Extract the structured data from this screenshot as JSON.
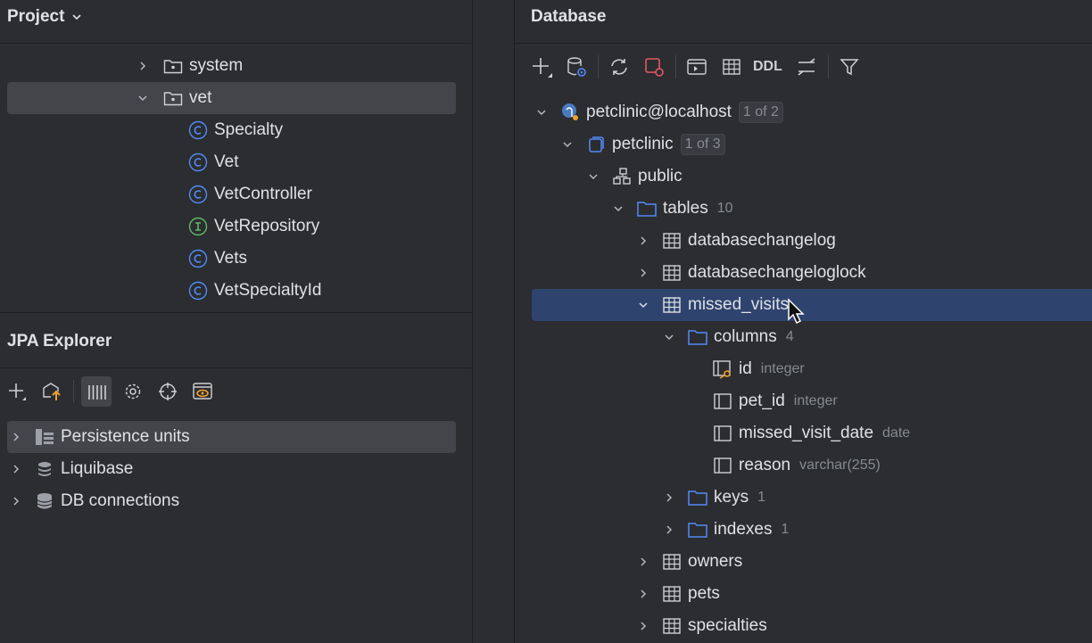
{
  "project": {
    "title": "Project",
    "tree": [
      {
        "label": "system",
        "kind": "package",
        "expanded": false
      },
      {
        "label": "vet",
        "kind": "package",
        "expanded": true,
        "selected": true
      },
      {
        "label": "Specialty",
        "kind": "class"
      },
      {
        "label": "Vet",
        "kind": "class"
      },
      {
        "label": "VetController",
        "kind": "class"
      },
      {
        "label": "VetRepository",
        "kind": "interface"
      },
      {
        "label": "Vets",
        "kind": "class"
      },
      {
        "label": "VetSpecialtyId",
        "kind": "class"
      }
    ]
  },
  "jpa": {
    "title": "JPA Explorer",
    "items": [
      {
        "label": "Persistence units",
        "icon": "persistence-icon",
        "selected": true
      },
      {
        "label": "Liquibase",
        "icon": "liquibase-icon"
      },
      {
        "label": "DB connections",
        "icon": "database-icon"
      }
    ]
  },
  "database": {
    "title": "Database",
    "toolbar": {
      "ddl_label": "DDL"
    },
    "tree": {
      "datasource": {
        "label": "petclinic@localhost",
        "badge": "1 of 2"
      },
      "database": {
        "label": "petclinic",
        "badge": "1 of 3"
      },
      "schema": {
        "label": "public"
      },
      "tables_folder": {
        "label": "tables",
        "count": "10"
      },
      "tables": [
        {
          "label": "databasechangelog"
        },
        {
          "label": "databasechangeloglock"
        },
        {
          "label": "missed_visits",
          "selected": true
        }
      ],
      "columns_folder": {
        "label": "columns",
        "count": "4"
      },
      "columns": [
        {
          "label": "id",
          "type": "integer",
          "key": true
        },
        {
          "label": "pet_id",
          "type": "integer"
        },
        {
          "label": "missed_visit_date",
          "type": "date"
        },
        {
          "label": "reason",
          "type": "varchar(255)"
        }
      ],
      "keys_folder": {
        "label": "keys",
        "count": "1"
      },
      "indexes_folder": {
        "label": "indexes",
        "count": "1"
      },
      "more_tables": [
        {
          "label": "owners"
        },
        {
          "label": "pets"
        },
        {
          "label": "specialties"
        }
      ]
    }
  },
  "colors": {
    "bg": "#2b2d30",
    "selection_blue": "#2e436e",
    "selection_grey": "#43454a",
    "class_icon": "#548af7",
    "interface_icon": "#5fb865",
    "folder_icon": "#548af7"
  }
}
